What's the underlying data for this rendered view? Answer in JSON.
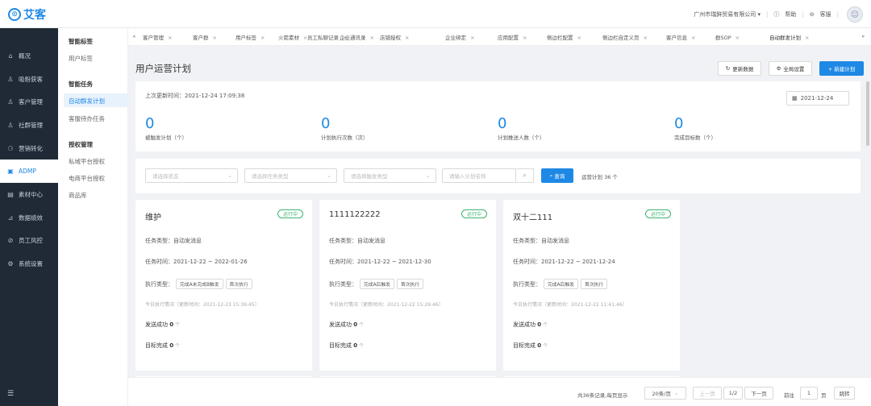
{
  "app": {
    "logo_text": "艾客",
    "logo_mark": "⊙",
    "company": "广州市瑞鲜贸易有限公司 ▾",
    "help": "帮助",
    "service": "客服"
  },
  "sidebar": {
    "items": [
      {
        "icon": "home-icon",
        "glyph": "⌂",
        "label": "概况"
      },
      {
        "icon": "user-plus-icon",
        "glyph": "♙",
        "label": "吸粉获客"
      },
      {
        "icon": "users-icon",
        "glyph": "♙",
        "label": "客户管理"
      },
      {
        "icon": "group-icon",
        "glyph": "♙",
        "label": "社群管理"
      },
      {
        "icon": "funnel-icon",
        "glyph": "⚆",
        "label": "营销转化"
      },
      {
        "icon": "adm-icon",
        "glyph": "▣",
        "label": "ADMP"
      },
      {
        "icon": "material-icon",
        "glyph": "▤",
        "label": "素材中心"
      },
      {
        "icon": "chart-icon",
        "glyph": "⊿",
        "label": "数据绩效"
      },
      {
        "icon": "shield-icon",
        "glyph": "⊘",
        "label": "员工风控"
      },
      {
        "icon": "gear-icon",
        "glyph": "⚙",
        "label": "系统设置"
      }
    ],
    "active_index": 5,
    "collapse_glyph": "☰"
  },
  "subnav": {
    "group1_title": "智能标签",
    "group1_items": [
      "用户标签"
    ],
    "group2_title": "智能任务",
    "group2_items": [
      "自动群发计划",
      "客服待办任务"
    ],
    "group3_title": "授权管理",
    "group3_items": [
      "私域平台授权",
      "电商平台授权",
      "商品库"
    ]
  },
  "tabs": [
    "客户管理",
    "客户群",
    "用户标签",
    "火箭素材",
    "员工私聊记录",
    "企业通讯录",
    "店铺授权",
    "企业绑定",
    "应用配置",
    "侧边栏配置",
    "侧边栏自定义页",
    "客户信息",
    "群SOP",
    "自动群发计划"
  ],
  "main": {
    "title": "用户运营计划",
    "btn_refresh": "更新数据",
    "btn_global": "全局设置",
    "btn_new": "+ 新建计划",
    "last_update": "上次更新时间：2021-12-24 17:09:38",
    "date": "2021-12-24",
    "stats": [
      {
        "value": "0",
        "label": "被触发计划（个）"
      },
      {
        "value": "0",
        "label": "计划执行次数（次）"
      },
      {
        "value": "0",
        "label": "计划推送人数（个）"
      },
      {
        "value": "0",
        "label": "完成目标数（个）"
      }
    ]
  },
  "filters": {
    "status_placeholder": "请选择状态",
    "task_type_placeholder": "请选择任务类型",
    "trigger_type_placeholder": "请选择触发类型",
    "name_placeholder": "请输入计划名称",
    "query_label": "查询",
    "plan_count": "运营计划 36 个"
  },
  "cards": [
    {
      "name": "维护",
      "status": "运行中",
      "task_type": "任务类型：自动发消息",
      "task_time": "任务时间：2021-12-22 ~ 2022-01-26",
      "exec_label": "执行类型：",
      "tag1": "完成A未完成B触发",
      "tag2": "首次执行",
      "today": "今日执行情况（更新时间：2021-12-23 15:36:45）",
      "sent_label": "发送成功",
      "sent_value": "0",
      "goal_label": "目标完成",
      "goal_value": "0",
      "unit": "个"
    },
    {
      "name": "1111122222",
      "status": "运行中",
      "task_type": "任务类型：自动发消息",
      "task_time": "任务时间：2021-12-22 ~ 2021-12-30",
      "exec_label": "执行类型：",
      "tag1": "完成A后触发",
      "tag2": "首次执行",
      "today": "今日执行情况（更新时间：2021-12-22 15:26:46）",
      "sent_label": "发送成功",
      "sent_value": "0",
      "goal_label": "目标完成",
      "goal_value": "0",
      "unit": "个"
    },
    {
      "name": "双十二111",
      "status": "运行中",
      "task_type": "任务类型：自动发消息",
      "task_time": "任务时间：2021-12-22 ~ 2021-12-24",
      "exec_label": "执行类型：",
      "tag1": "完成A后触发",
      "tag2": "首次执行",
      "today": "今日执行情况（更新时间：2021-12-22 11:41:46）",
      "sent_label": "发送成功",
      "sent_value": "0",
      "goal_label": "目标完成",
      "goal_value": "0",
      "unit": "个"
    }
  ],
  "pager": {
    "summary": "共36条记录,每页显示",
    "page_size": "20条/页",
    "prev": "上一页",
    "page_info": "1/2",
    "next": "下一页",
    "goto_label": "前往",
    "goto_value": "1",
    "page_unit": "页",
    "jump": "跳转"
  }
}
